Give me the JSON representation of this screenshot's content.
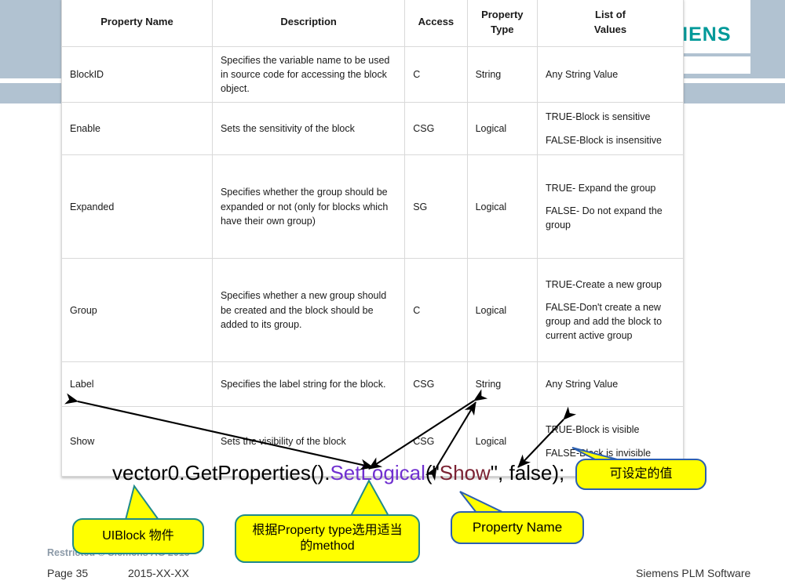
{
  "brand": {
    "logo_text": "SIEMENS",
    "logo_color": "#009999",
    "band_color": "#b1c2d1"
  },
  "table": {
    "headers": [
      "Property Name",
      "Description",
      "Access",
      "Property\nType",
      "List of\nValues"
    ],
    "header_lines": {
      "h0": "Property Name",
      "h1": "Description",
      "h2": "Access",
      "h3a": "Property",
      "h3b": "Type",
      "h4a": "List of",
      "h4b": "Values"
    },
    "rows": [
      {
        "name": "BlockID",
        "description": "Specifies the variable name to be used in source code for accessing the block object.",
        "access": "C",
        "type": "String",
        "values": [
          "Any String Value"
        ]
      },
      {
        "name": "Enable",
        "description": "Sets the sensitivity of the block",
        "access": "CSG",
        "type": "Logical",
        "values": [
          "TRUE-Block is sensitive",
          "FALSE-Block is insensitive"
        ]
      },
      {
        "name": "Expanded",
        "description": "Specifies whether the group should be expanded or not (only for blocks which have their own group)",
        "access": "SG",
        "type": "Logical",
        "values": [
          "TRUE- Expand the group",
          "FALSE- Do not expand the group"
        ]
      },
      {
        "name": "Group",
        "description": "Specifies whether a new group should be created and the block should be added to its group.",
        "access": "C",
        "type": "Logical",
        "values": [
          "TRUE-Create a new group",
          "FALSE-Don't create a new group and add the block to current active group"
        ]
      },
      {
        "name": "Label",
        "description": "Specifies the label string for the block.",
        "access": "CSG",
        "type": "String",
        "values": [
          "Any String Value"
        ]
      },
      {
        "name": "Show",
        "description": "Sets the visibility of the block",
        "access": "CSG",
        "type": "Logical",
        "values": [
          "TRUE-Block is visible",
          "FALSE-Block is invisible"
        ]
      }
    ]
  },
  "code": {
    "prefix": "vector0.GetProperties().",
    "method": "SetLogical",
    "open_paren": "(\"",
    "string_arg": "Show",
    "suffix": "\", false);",
    "method_color": "#7030d0",
    "string_color": "#7b2233"
  },
  "callouts": [
    {
      "id": "uiblock",
      "text": "UIBlock 物件",
      "border_color": "#1f8a8a",
      "fill": "#ffff00"
    },
    {
      "id": "method",
      "text": "根据Property type选用适当的method",
      "border_color": "#1f8a8a",
      "fill": "#ffff00"
    },
    {
      "id": "propname",
      "text": "Property Name",
      "border_color": "#2b5fb0",
      "fill": "#ffff00"
    },
    {
      "id": "value",
      "text": "可设定的值",
      "border_color": "#2b5fb0",
      "fill": "#ffff00"
    }
  ],
  "callout_text": {
    "uiblock": "UIBlock 物件",
    "method_line1": "根据Property type选用适当",
    "method_line2": "的method",
    "propname": "Property Name",
    "value": "可设定的值"
  },
  "footer": {
    "restricted": "Restricted © Siemens AG 2015",
    "page": "Page 35",
    "date": "2015-XX-XX",
    "brand": "Siemens PLM Software"
  }
}
